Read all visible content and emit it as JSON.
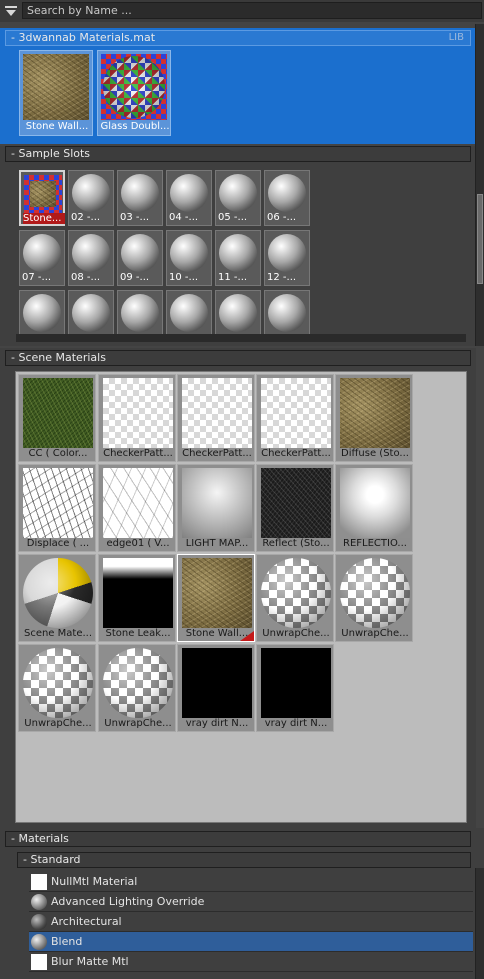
{
  "search": {
    "placeholder": "Search by Name ..."
  },
  "library": {
    "title": "3dwannab Materials.mat",
    "badge": "LIB",
    "items": [
      {
        "label": "Stone Wall...",
        "thumb": "stone-cube"
      },
      {
        "label": "Glass Doubl...",
        "thumb": "glass-sphere"
      }
    ]
  },
  "sample_slots": {
    "title": "Sample Slots",
    "slots": [
      "Stone...",
      "02 -...",
      "03 -...",
      "04 -...",
      "05 -...",
      "06 -...",
      "07 -...",
      "08 -...",
      "09 -...",
      "10 -...",
      "11 -...",
      "12 -...",
      "",
      "",
      "",
      "",
      "",
      ""
    ]
  },
  "scene_materials": {
    "title": "Scene Materials",
    "items": [
      {
        "label": "CC  ( Color...",
        "thumb": "grass"
      },
      {
        "label": "CheckerPatt...",
        "thumb": "checker"
      },
      {
        "label": "CheckerPatt...",
        "thumb": "checker"
      },
      {
        "label": "CheckerPatt...",
        "thumb": "checker"
      },
      {
        "label": "Diffuse (Sto...",
        "thumb": "stone"
      },
      {
        "label": "Displace  ( ...",
        "thumb": "noise-white"
      },
      {
        "label": "edge01  ( V...",
        "thumb": "noise-light"
      },
      {
        "label": "LIGHT MAP...",
        "thumb": "lightmap"
      },
      {
        "label": "Reflect (Sto...",
        "thumb": "reflect"
      },
      {
        "label": "REFLECTIO...",
        "thumb": "reflectio"
      },
      {
        "label": "Scene Mate...",
        "thumb": "ball-scene"
      },
      {
        "label": "Stone Leak...",
        "thumb": "leak"
      },
      {
        "label": "Stone Wall...",
        "thumb": "stone-cube"
      },
      {
        "label": "UnwrapChe...",
        "thumb": "ball-check"
      },
      {
        "label": "UnwrapChe...",
        "thumb": "ball-check"
      },
      {
        "label": "UnwrapChe...",
        "thumb": "ball-check"
      },
      {
        "label": "UnwrapChe...",
        "thumb": "ball-check"
      },
      {
        "label": "vray dirt N...",
        "thumb": "black"
      },
      {
        "label": "vray dirt N...",
        "thumb": "black"
      }
    ]
  },
  "materials": {
    "title": "Materials",
    "group": "Standard",
    "items": [
      {
        "label": "NullMtl Material",
        "icon": "white-swatch"
      },
      {
        "label": "Advanced Lighting Override",
        "icon": "grey-sphere"
      },
      {
        "label": "Architectural",
        "icon": "dark-sphere"
      },
      {
        "label": "Blend",
        "icon": "grey-sphere",
        "highlighted": true
      },
      {
        "label": "Blur Matte Mtl",
        "icon": "white-swatch"
      }
    ]
  }
}
